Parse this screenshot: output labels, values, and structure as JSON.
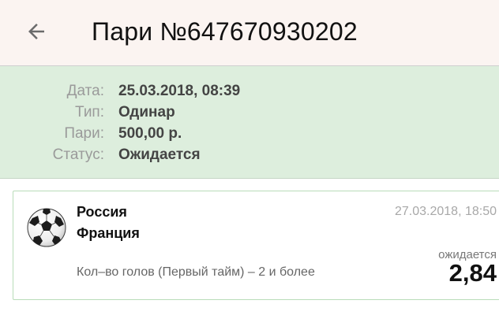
{
  "appbar": {
    "back_icon": "arrow-left-icon",
    "title": "Пари №647670930202"
  },
  "info": {
    "date_label": "Дата:",
    "date_value": "25.03.2018, 08:39",
    "type_label": "Тип:",
    "type_value": "Одинар",
    "stake_label": "Пари:",
    "stake_value": "500,00 р.",
    "status_label": "Статус:",
    "status_value": "Ожидается"
  },
  "bet": {
    "sport_icon": "soccer-ball-icon",
    "team_home": "Россия",
    "team_away": "Франция",
    "event_datetime": "27.03.2018, 18:50",
    "market": "Кол–во голов (Первый тайм) – 2 и более",
    "status": "ожидается",
    "odds": "2,84"
  },
  "colors": {
    "appbar_bg": "#fbf4f1",
    "info_bg": "#ddeedd",
    "card_border": "#b9dcb9"
  }
}
